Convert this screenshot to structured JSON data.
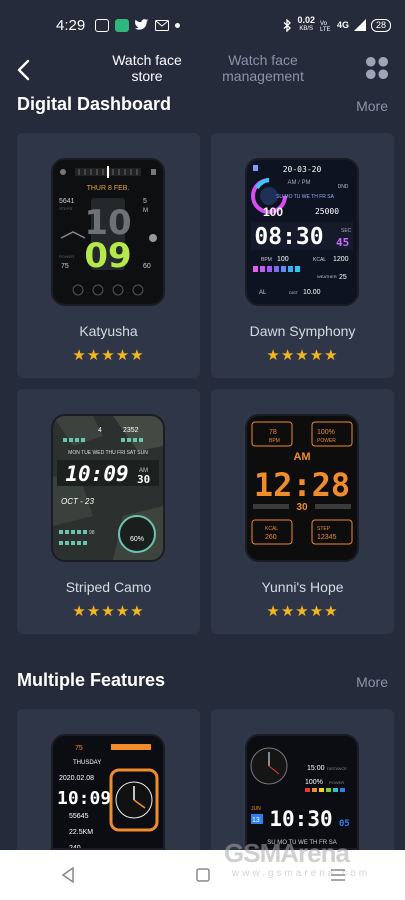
{
  "status": {
    "time": "4:29",
    "speed_value": "0.02",
    "speed_unit": "KB/S",
    "network": "4G",
    "battery": "28"
  },
  "header": {
    "store_tab": "Watch face store",
    "manage_tab": "Watch face management"
  },
  "sections": [
    {
      "title": "Digital Dashboard",
      "more": "More",
      "cards": [
        {
          "name": "Katyusha",
          "rating": 5
        },
        {
          "name": "Dawn Symphony",
          "rating": 5
        },
        {
          "name": "Striped Camo",
          "rating": 5
        },
        {
          "name": "Yunni's Hope",
          "rating": 5
        }
      ]
    },
    {
      "title": "Multiple Features",
      "more": "More"
    }
  ],
  "faces": {
    "katyusha": {
      "date": "THUR 8 FEB.",
      "hour": "10",
      "minute": "09",
      "steps": "5641",
      "steps_label": "STEPS",
      "val2": "5",
      "val2_label": "M",
      "power": "75",
      "power_label": "POWER",
      "temp": "60"
    },
    "dawn": {
      "date": "20-03-20",
      "ampm": "AM / PM",
      "dnd": "DND",
      "days": "SU MO TU WE TH FR SA",
      "battery": "100",
      "steps": "25000",
      "time": "08:30",
      "sec_label": "SEC",
      "sec": "45",
      "bpm": "100",
      "bpm_label": "BPM",
      "kcal": "1200",
      "kcal_label": "KCAL",
      "weather": "25",
      "weather_label": "WEATHER",
      "al": "AL",
      "dist": "10.00",
      "dist_label": "DIST"
    },
    "camo": {
      "top_left": "4",
      "top_right": "2352",
      "days": "MON TUE WED THU FRI SAT SUN",
      "time": "10:09",
      "sec": "30",
      "ampm": "AM",
      "date": "OCT - 23",
      "hr": "98",
      "pct": "60%"
    },
    "yunni": {
      "hr": "78",
      "hr_label": "BPM",
      "power": "100%",
      "power_label": "POWER",
      "ampm": "AM",
      "time": "12:28",
      "sec": "30",
      "kcal_label": "KCAL",
      "kcal": "260",
      "step_label": "STEP",
      "step": "12345"
    },
    "multi1": {
      "battery": "75",
      "day": "THUSDAY",
      "date": "2020.02.08",
      "time": "10:09",
      "steps": "55645",
      "dist": "22.5KM",
      "extra": "240"
    },
    "multi2": {
      "val1": "15:00",
      "val1_label": "DISTANCE",
      "power": "100%",
      "power_label": "POWER",
      "month": "JUN",
      "day": "13",
      "time": "10:30",
      "sec": "05",
      "days": "SU MO TU WE TH FR SA"
    }
  },
  "watermark": "GSMArena",
  "watermark_sub": "www.gsmarena.com",
  "colors": {
    "background": "#252b3b",
    "card": "#2f3648",
    "star": "#f5b81c",
    "muted": "#8b93a8"
  }
}
